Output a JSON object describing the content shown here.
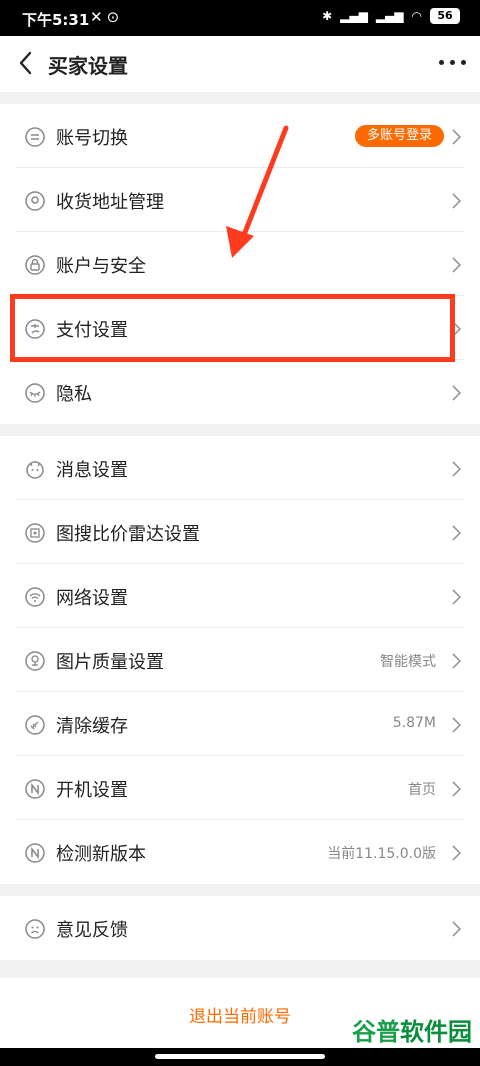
{
  "status_bar": {
    "time": "下午5:31",
    "battery": "56"
  },
  "header": {
    "title": "买家设置"
  },
  "group1": [
    {
      "label": "账号切换",
      "badge": "多账号登录",
      "icon": "switch-account-icon"
    },
    {
      "label": "收货地址管理",
      "icon": "location-icon"
    },
    {
      "label": "账户与安全",
      "icon": "lock-icon"
    },
    {
      "label": "支付设置",
      "icon": "payment-icon"
    },
    {
      "label": "隐私",
      "icon": "eye-closed-icon"
    }
  ],
  "group2": [
    {
      "label": "消息设置",
      "icon": "message-icon"
    },
    {
      "label": "图搜比价雷达设置",
      "icon": "image-search-icon"
    },
    {
      "label": "网络设置",
      "icon": "wifi-icon"
    },
    {
      "label": "图片质量设置",
      "value": "智能模式",
      "icon": "image-quality-icon"
    },
    {
      "label": "清除缓存",
      "value": "5.87M",
      "icon": "broom-icon"
    },
    {
      "label": "开机设置",
      "value": "首页",
      "icon": "startup-icon"
    },
    {
      "label": "检测新版本",
      "value": "当前11.15.0.0版",
      "icon": "version-icon"
    }
  ],
  "group3": [
    {
      "label": "意见反馈",
      "icon": "feedback-icon"
    }
  ],
  "footer": {
    "logout": "退出当前账号"
  },
  "watermark": {
    "part1": "谷普",
    "part2": "软件园"
  },
  "colors": {
    "accent": "#ff6a00",
    "annotation_red": "#ff3b1f"
  }
}
